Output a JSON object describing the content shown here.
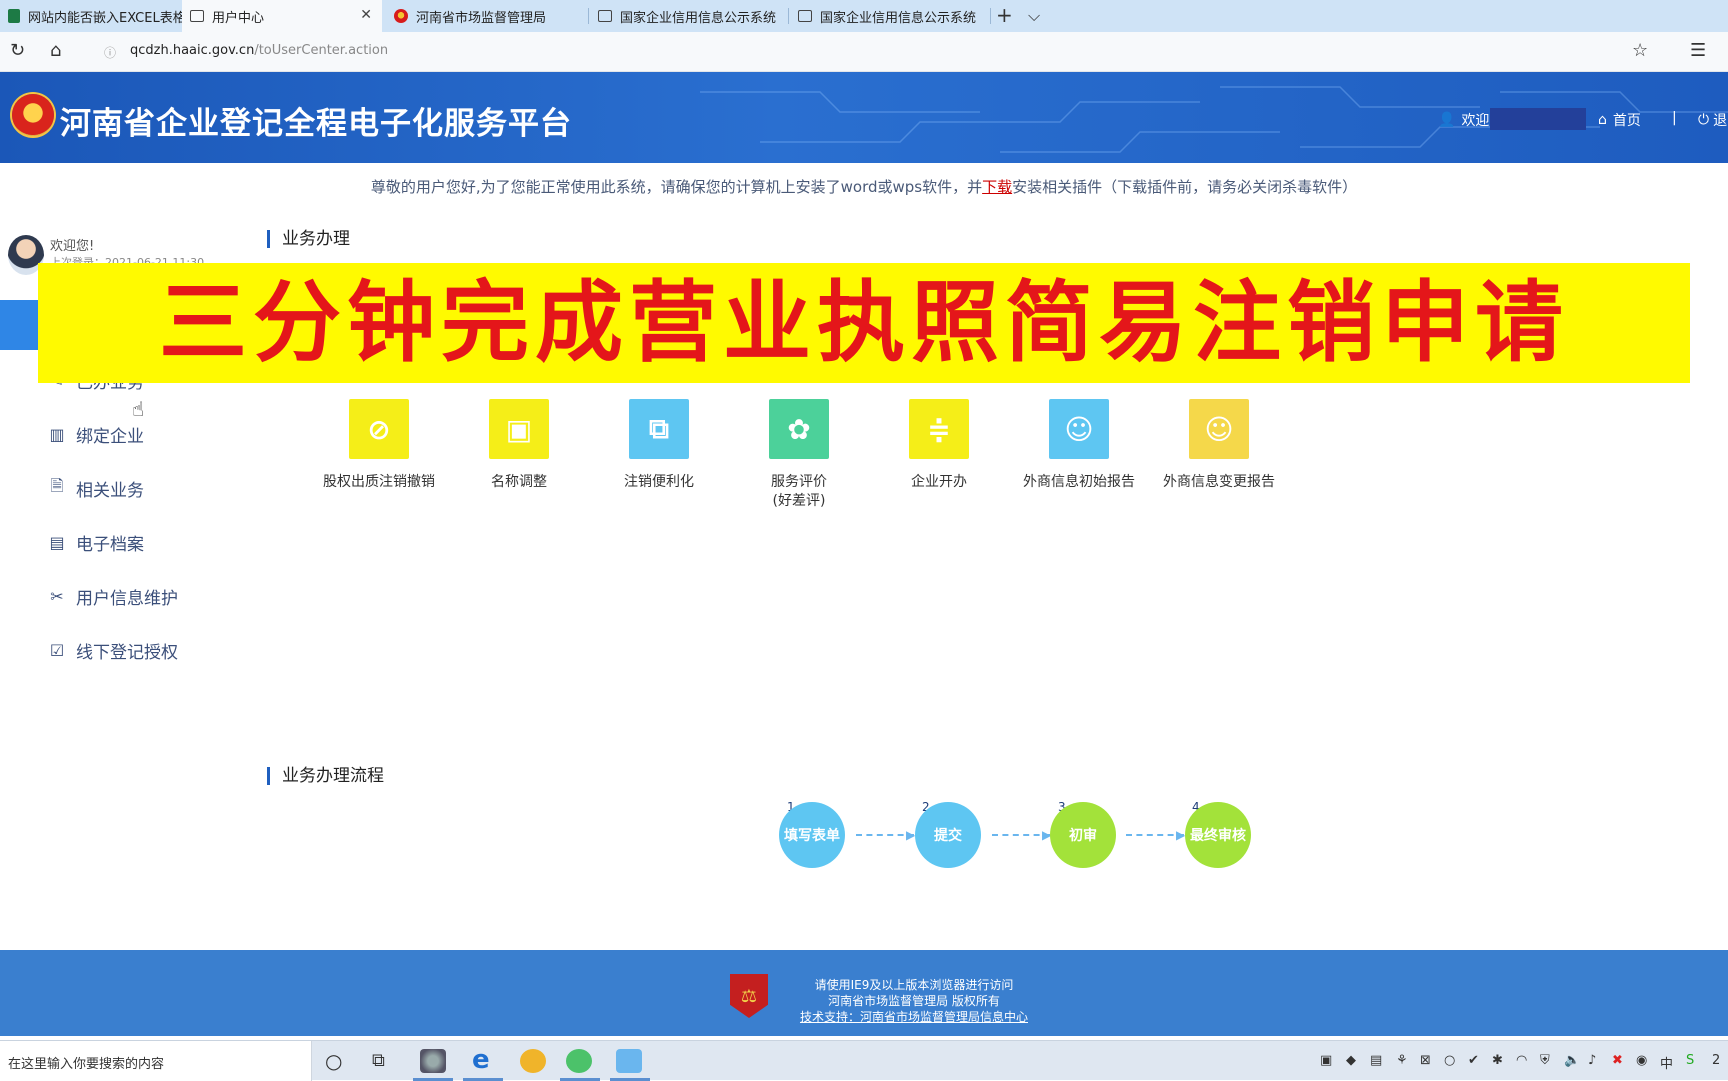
{
  "browser": {
    "tabs": [
      {
        "title": "网站内能否嵌入EXCEL表格_",
        "icon": "excel-icon"
      },
      {
        "title": "用户中心",
        "icon": "page-icon",
        "active": true
      },
      {
        "title": "河南省市场监督管理局",
        "icon": "emblem-icon"
      },
      {
        "title": "国家企业信用信息公示系统",
        "icon": "page-icon"
      },
      {
        "title": "国家企业信用信息公示系统",
        "icon": "page-icon"
      }
    ],
    "new_tab": "+",
    "tab_list": "⌵",
    "url_host": "qcdzh.haaic.gov.cn",
    "url_path": "/toUserCenter.action"
  },
  "header": {
    "title": "河南省企业登记全程电子化服务平台",
    "welcome": "欢迎!",
    "home": "首页",
    "separator": "|",
    "logout": "退"
  },
  "notice": {
    "before": "尊敬的用户您好,为了您能正常使用此系统，请确保您的计算机上安装了word或wps软件，并",
    "link": "下载",
    "after": "安装相关插件（下载插件前，请务必关闭杀毒软件）"
  },
  "sidebar": {
    "welcome": "欢迎您!",
    "last_login": "上次登录：2021-06-21 11:30",
    "active_item": "",
    "partial_item": "已办业务",
    "items": [
      {
        "label": "绑定企业",
        "icon": "building-icon"
      },
      {
        "label": "相关业务",
        "icon": "document-search-icon"
      },
      {
        "label": "电子档案",
        "icon": "archive-icon"
      },
      {
        "label": "用户信息维护",
        "icon": "tools-icon"
      },
      {
        "label": "线下登记授权",
        "icon": "clipboard-check-icon"
      }
    ]
  },
  "sections": {
    "business": "业务办理",
    "flow": "业务办理流程"
  },
  "banner": {
    "text": "三分钟完成营业执照简易注销申请",
    "bg": "#fffa00",
    "color": "#e4161a"
  },
  "services": [
    {
      "label": "股权出质注销撤销",
      "color": "#f5ee18",
      "icon": "equity-cancel-icon"
    },
    {
      "label": "名称调整",
      "color": "#f5ee18",
      "icon": "name-adjust-icon"
    },
    {
      "label": "注销便利化",
      "color": "#5ec6f2",
      "icon": "cancel-facilitation-icon"
    },
    {
      "label": "服务评价",
      "label2": "(好差评)",
      "color": "#4cd19a",
      "icon": "service-rating-icon"
    },
    {
      "label": "企业开办",
      "color": "#f5ee18",
      "icon": "enterprise-open-icon"
    },
    {
      "label": "外商信息初始报告",
      "color": "#5ec6f2",
      "icon": "foreign-initial-report-icon"
    },
    {
      "label": "外商信息变更报告",
      "color": "#f5d84a",
      "icon": "foreign-change-report-icon"
    }
  ],
  "flow": [
    {
      "num": "1",
      "label": "填写表单",
      "color": "#5ec6f2"
    },
    {
      "num": "2",
      "label": "提交",
      "color": "#5ec6f2"
    },
    {
      "num": "3",
      "label": "初审",
      "color": "#a3e23a"
    },
    {
      "num": "4",
      "label": "最终审核",
      "color": "#a3e23a"
    }
  ],
  "footer": {
    "line1": "请使用IE9及以上版本浏览器进行访问",
    "line2": "河南省市场监督管理局 版权所有",
    "line3": "技术支持：河南省市场监督管理局信息中心"
  },
  "taskbar": {
    "search_placeholder": "在这里输入你要搜索的内容",
    "clock_partial": "2"
  }
}
